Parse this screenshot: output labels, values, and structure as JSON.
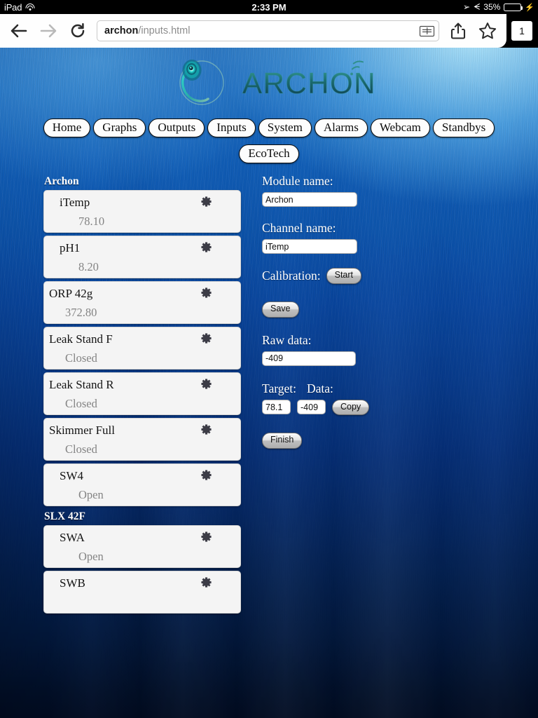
{
  "status_bar": {
    "carrier": "iPad",
    "wifi_icon": "wifi-icon",
    "time": "2:33 PM",
    "location_icon": "location-arrow-icon",
    "bluetooth_icon": "bluetooth-icon",
    "battery_percent": "35%",
    "battery_level": 35,
    "charging_icon": "lightning-bolt-icon"
  },
  "browser": {
    "back_icon": "back-arrow-icon",
    "forward_icon": "forward-arrow-icon",
    "reload_icon": "reload-icon",
    "url_domain": "archon",
    "url_path": "/inputs.html",
    "url_full": "archon/inputs.html",
    "reader_icon": "reader-view-icon",
    "share_icon": "share-icon",
    "bookmark_icon": "bookmark-star-icon",
    "tab_count": "1"
  },
  "logo": {
    "wordmark": "ARCHON",
    "mark_icon": "archon-swirl-icon",
    "signal_icon": "wifi-signal-icon",
    "ink": "#1d6b6b",
    "glow": "#19e0d8"
  },
  "nav": {
    "row1": [
      {
        "label": "Home",
        "name": "nav-home"
      },
      {
        "label": "Graphs",
        "name": "nav-graphs"
      },
      {
        "label": "Outputs",
        "name": "nav-outputs"
      },
      {
        "label": "Inputs",
        "name": "nav-inputs"
      },
      {
        "label": "System",
        "name": "nav-system"
      },
      {
        "label": "Alarms",
        "name": "nav-alarms"
      },
      {
        "label": "Webcam",
        "name": "nav-webcam"
      },
      {
        "label": "Standbys",
        "name": "nav-standbys"
      }
    ],
    "row2": [
      {
        "label": "EcoTech",
        "name": "nav-ecotech"
      }
    ]
  },
  "channel_list": {
    "groups": [
      {
        "header": "Archon",
        "items": [
          {
            "title": "iTemp",
            "value": "78.10",
            "indent": true
          },
          {
            "title": "pH1",
            "value": "8.20",
            "indent": true
          },
          {
            "title": "ORP 42g",
            "value": "372.80",
            "indent": false
          },
          {
            "title": "Leak Stand F",
            "value": "Closed",
            "indent": false
          },
          {
            "title": "Leak Stand R",
            "value": "Closed",
            "indent": false
          },
          {
            "title": "Skimmer Full",
            "value": "Closed",
            "indent": false
          },
          {
            "title": "SW4",
            "value": "Open",
            "indent": true
          }
        ]
      },
      {
        "header": "SLX 42F",
        "items": [
          {
            "title": "SWA",
            "value": "Open",
            "indent": true
          },
          {
            "title": "SWB",
            "value": "",
            "indent": true
          }
        ]
      }
    ],
    "gear_icon": "gear-icon"
  },
  "form": {
    "module_label": "Module name:",
    "module_value": "Archon",
    "channel_label": "Channel name:",
    "channel_value": "iTemp",
    "calibration_label": "Calibration:",
    "start_label": "Start",
    "save_label": "Save",
    "raw_label": "Raw data:",
    "raw_value": "-409",
    "target_label": "Target:",
    "data_label": "Data:",
    "target_value": "78.1",
    "data_value": "-409",
    "copy_label": "Copy",
    "finish_label": "Finish"
  }
}
